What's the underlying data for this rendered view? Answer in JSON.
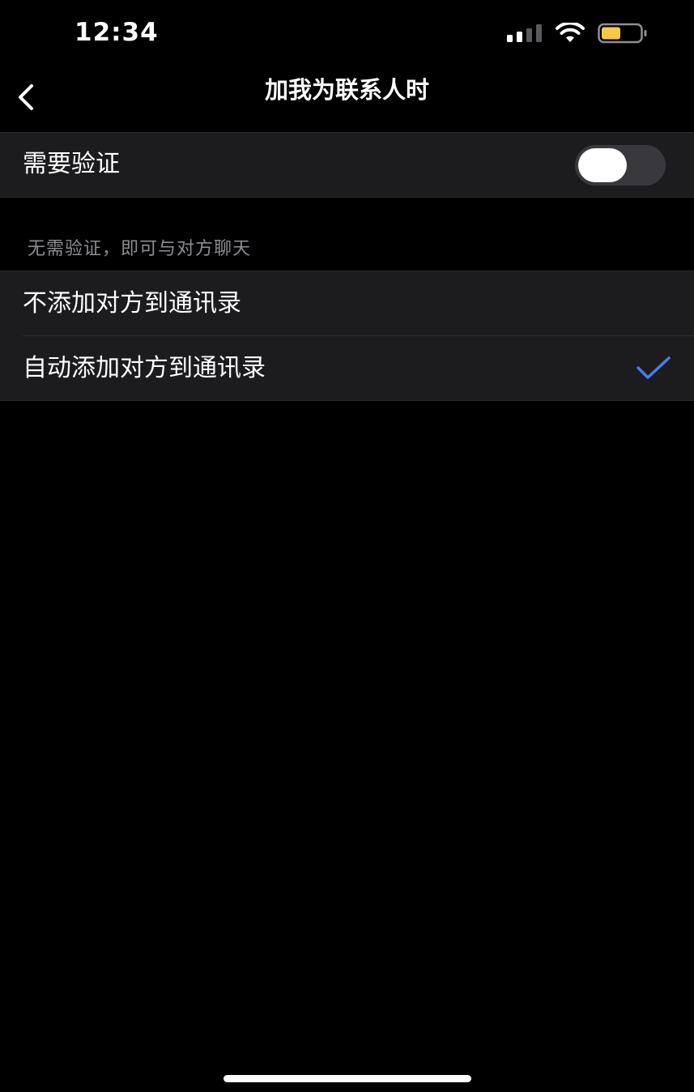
{
  "status_bar": {
    "time": "12:34",
    "icons": [
      "signal-icon",
      "wifi-icon",
      "battery-icon"
    ],
    "battery_color": "#f5c944"
  },
  "nav": {
    "title": "加我为联系人时",
    "back_icon": "chevron-left-icon"
  },
  "verify": {
    "label": "需要验证",
    "enabled": false
  },
  "options_section": {
    "caption": "无需验证，即可与对方聊天",
    "items": [
      {
        "label": "不添加对方到通讯录",
        "selected": false
      },
      {
        "label": "自动添加对方到通讯录",
        "selected": true
      }
    ],
    "check_color": "#4a7cf0"
  },
  "colors": {
    "background": "#000000",
    "cell_background": "#1c1c1e",
    "caption_text": "#8d8d93"
  }
}
